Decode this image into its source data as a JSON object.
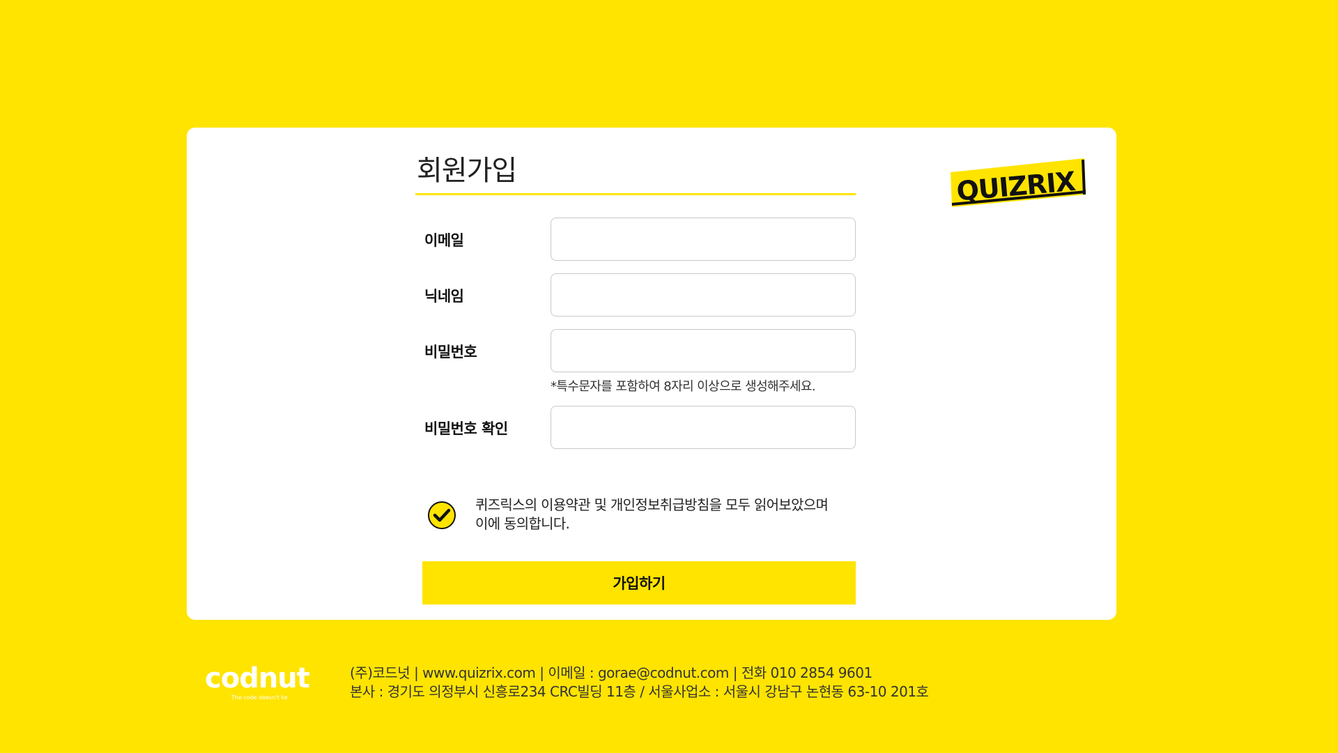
{
  "signup": {
    "title": "회원가입",
    "fields": [
      {
        "label": "이메일",
        "value": "",
        "placeholder": ""
      },
      {
        "label": "닉네임",
        "value": "",
        "placeholder": ""
      },
      {
        "label": "비밀번호",
        "value": "",
        "placeholder": ""
      },
      {
        "label": "비밀번호 확인",
        "value": "",
        "placeholder": ""
      }
    ],
    "password_hint": "*특수문자를 포함하여 8자리 이상으로 생성해주세요.",
    "agree": {
      "checked": true,
      "line1": "퀴즈릭스의 이용약관 및 개인정보취급방침을 모두 읽어보았으며",
      "line2": "이에 동의합니다."
    },
    "submit_label": "가입하기"
  },
  "brand": {
    "logo_text": "QUIZRIX",
    "colors": {
      "background": "#FFE400",
      "accent": "#FFE400",
      "text": "#111111"
    }
  },
  "footer": {
    "logo_text": "codnut",
    "logo_tagline": "The code doesn't lie",
    "line1": "(주)코드넛  |  www.quizrix.com  |  이메일 : gorae@codnut.com  |  전화 010 2854 9601",
    "line2": "본사 : 경기도 의정부시 신흥로234 CRC빌딩 11층 / 서울사업소 : 서울시 강남구 논현동 63-10 201호"
  }
}
